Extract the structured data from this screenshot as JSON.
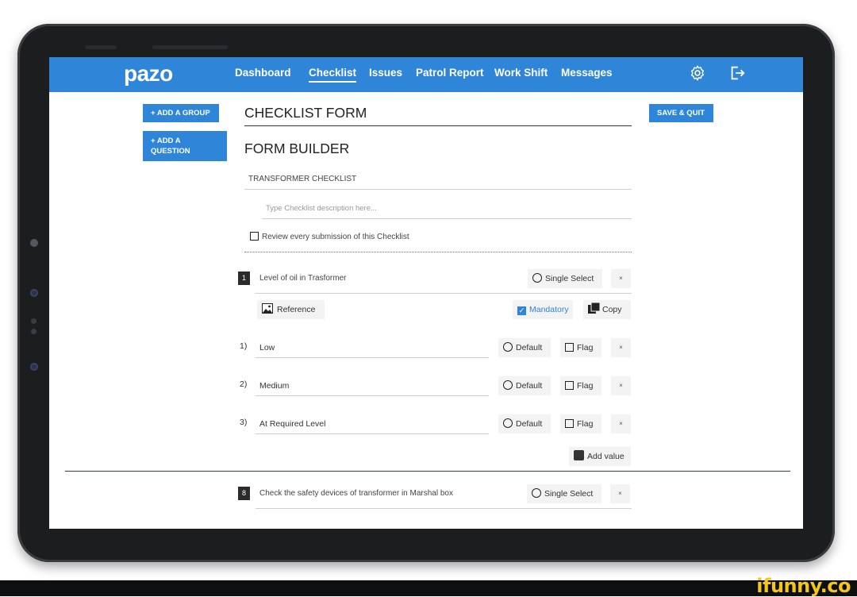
{
  "nav": {
    "logo": "pazo",
    "items": [
      {
        "label": "Dashboard"
      },
      {
        "label": "Checklist"
      },
      {
        "label": "Issues"
      },
      {
        "label": "Patrol Report"
      },
      {
        "label": "Work Shift"
      },
      {
        "label": "Messages"
      }
    ],
    "active": "Checklist",
    "icons": [
      "gear-icon",
      "logout-icon"
    ]
  },
  "sidebar": {
    "add_group": "+ ADD A GROUP",
    "add_question": "+ ADD A QUESTION"
  },
  "form": {
    "title": "CHECKLIST FORM",
    "save_quit": "SAVE & QUIT",
    "builder_title": "FORM BUILDER",
    "checklist_name": "TRANSFORMER CHECKLIST",
    "description_placeholder": "Type Checklist description here...",
    "review_label": "Review every submission of this Checklist"
  },
  "questions": [
    {
      "number": "1",
      "text": "Level of oil in Trasformer",
      "type": "Single Select",
      "reference_label": "Reference",
      "mandatory_label": "Mandatory",
      "mandatory_checked": true,
      "copy_label": "Copy",
      "options": [
        {
          "index": "1)",
          "value": "Low",
          "default_label": "Default",
          "flag_label": "Flag"
        },
        {
          "index": "2)",
          "value": "Medium",
          "default_label": "Default",
          "flag_label": "Flag"
        },
        {
          "index": "3)",
          "value": "At Required Level",
          "default_label": "Default",
          "flag_label": "Flag"
        }
      ],
      "add_value_label": "Add value"
    },
    {
      "number": "8",
      "text": "Check the safety devices of transformer in Marshal box",
      "type": "Single Select"
    }
  ],
  "remove_symbol": "×",
  "colors": {
    "primary": "#2f86d8",
    "device": "#1c1d1f",
    "watermark": "#f5c518"
  },
  "watermark": "ifunny.co"
}
